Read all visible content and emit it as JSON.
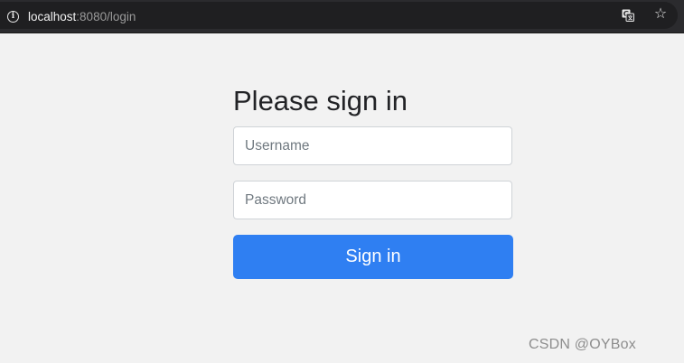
{
  "browser": {
    "url_host": "localhost",
    "url_rest": ":8080/login",
    "info_icon": "info-icon",
    "translate_icon": "translate-icon",
    "bookmark_icon": "star-icon"
  },
  "login": {
    "title": "Please sign in",
    "username_placeholder": "Username",
    "username_value": "",
    "password_placeholder": "Password",
    "password_value": "",
    "submit_label": "Sign in"
  },
  "watermark": "CSDN @OYBox",
  "colors": {
    "page_background": "#f2f2f2",
    "address_bar": "#2b2b2e",
    "primary_button": "#2f7ff2",
    "title_text": "#222326"
  }
}
